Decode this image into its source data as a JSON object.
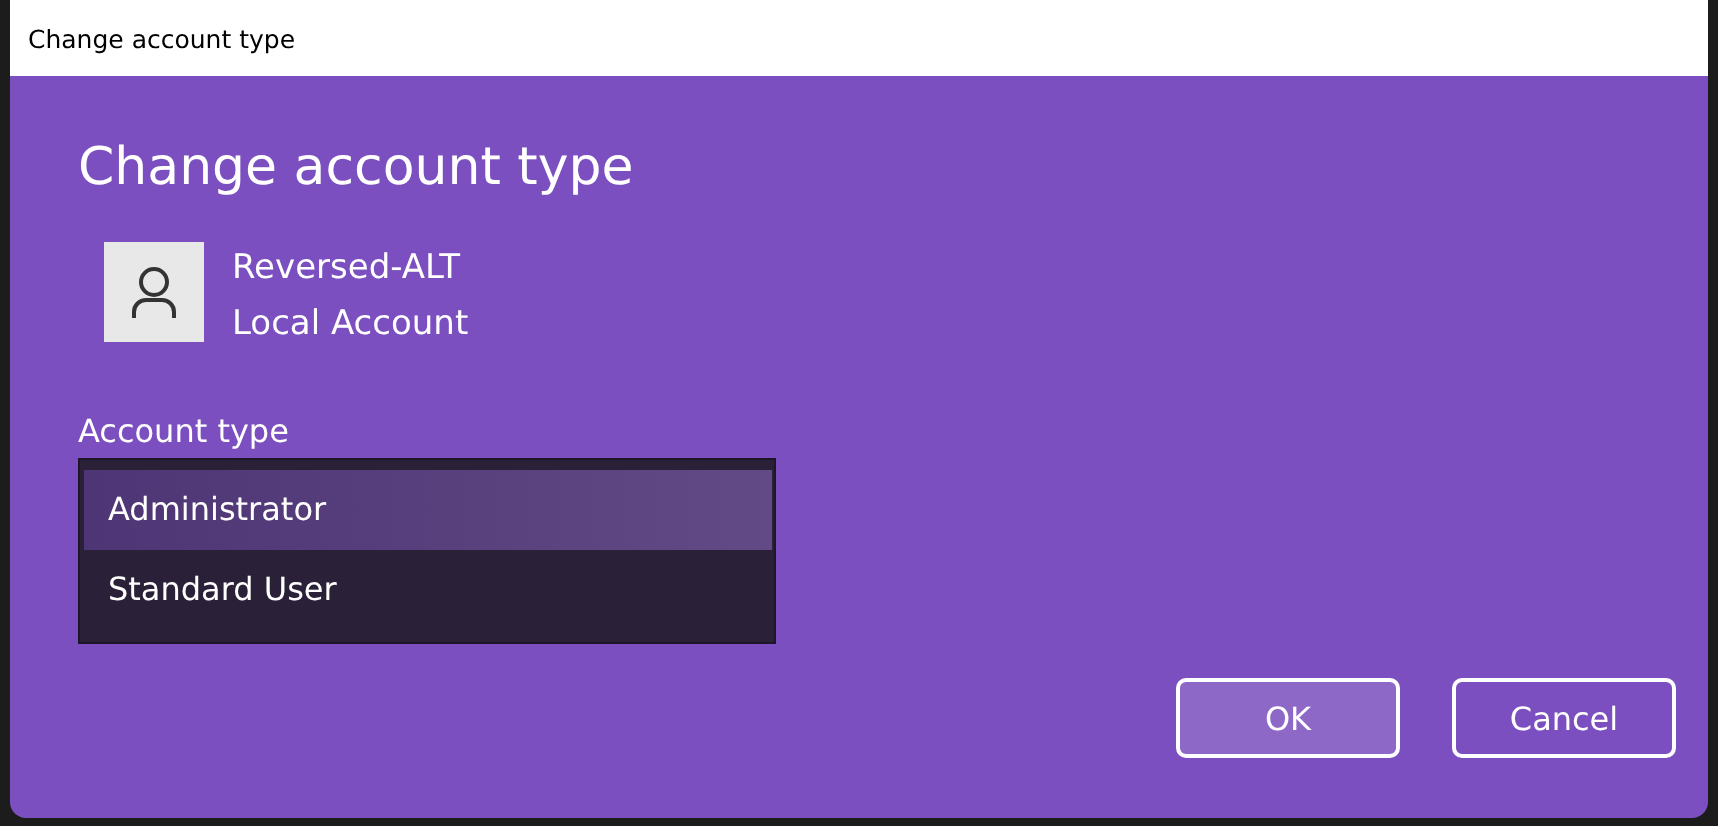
{
  "window": {
    "title": "Change account type"
  },
  "heading": "Change account type",
  "account": {
    "name": "Reversed-ALT",
    "type": "Local Account"
  },
  "account_type": {
    "label": "Account type",
    "options": [
      {
        "label": "Administrator",
        "selected": true
      },
      {
        "label": "Standard User",
        "selected": false
      }
    ]
  },
  "buttons": [
    {
      "label": "OK",
      "kind": "primary"
    },
    {
      "label": "Cancel",
      "kind": "secondary"
    }
  ]
}
